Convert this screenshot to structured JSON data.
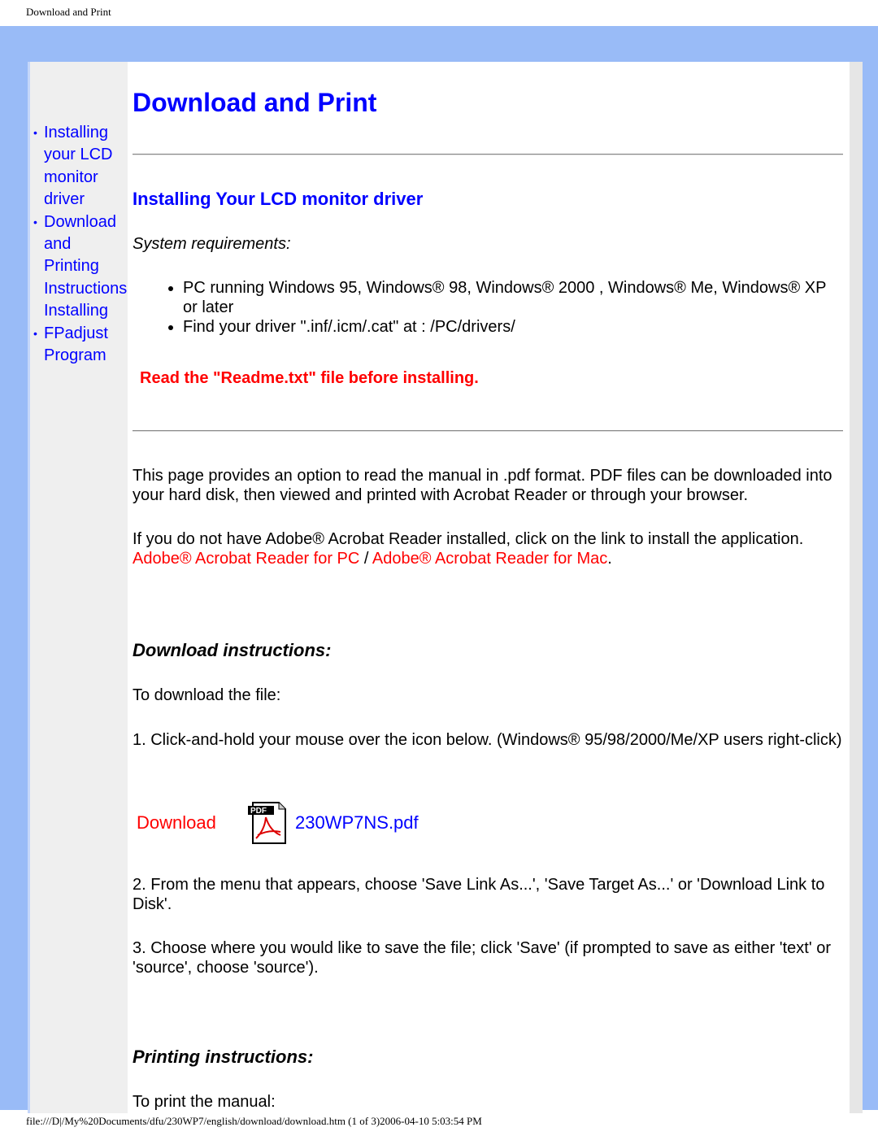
{
  "browser": {
    "header": "Download and Print",
    "footer": "file:///D|/My%20Documents/dfu/230WP7/english/download/download.htm (1 of 3)2006-04-10 5:03:54 PM"
  },
  "nav": [
    {
      "label": "Installing your LCD monitor driver"
    },
    {
      "label": "Download and Printing Instructions"
    },
    {
      "label": "Installing"
    },
    {
      "label": "FPadjust Program"
    }
  ],
  "page": {
    "title": "Download and Print",
    "section1": "Installing Your LCD monitor driver",
    "sysreq": "System requirements:",
    "reqs": [
      "PC running Windows 95, Windows® 98, Windows® 2000 , Windows® Me, Windows® XP or later",
      "Find your driver \".inf/.icm/.cat\" at : /PC/drivers/"
    ],
    "readme": "Read the \"Readme.txt\" file before installing.",
    "p1": "This page provides an option to read the manual in .pdf format. PDF files can be downloaded into your hard disk, then viewed and printed with Acrobat Reader or through your browser.",
    "p2": "If you do not have Adobe® Acrobat Reader installed, click on the link to install the application.",
    "link_pc": "Adobe® Acrobat Reader for PC",
    "sep": " / ",
    "link_mac": "Adobe® Acrobat Reader for Mac",
    "dot": ".",
    "dl_heading": "Download instructions:",
    "dl_intro": "To download the file:",
    "step1": "1. Click-and-hold your mouse over the icon below. (Windows® 95/98/2000/Me/XP users right-click)",
    "download_label": "Download",
    "pdf_icon_text": "PDF",
    "pdf_file": "230WP7NS.pdf",
    "step2": "2. From the menu that appears, choose 'Save Link As...', 'Save Target As...' or 'Download Link to Disk'.",
    "step3": "3. Choose where you would like to save the file; click 'Save' (if prompted to save as either 'text' or 'source', choose 'source').",
    "print_heading": "Printing instructions:",
    "print_intro": "To print the manual:"
  }
}
